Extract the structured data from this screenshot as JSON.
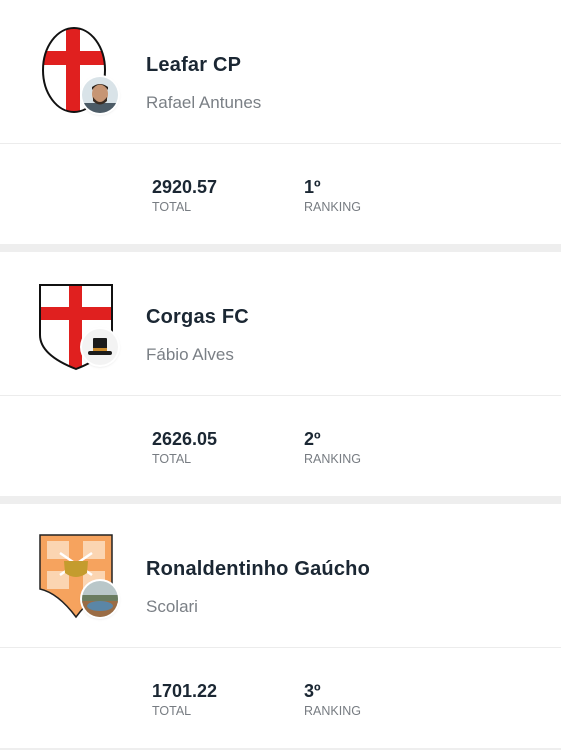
{
  "labels": {
    "total": "TOTAL",
    "ranking": "RANKING"
  },
  "teams": [
    {
      "team_name": "Leafar CP",
      "manager": "Rafael Antunes",
      "total": "2920.57",
      "ranking": "1º",
      "crest": "red-cross-oval-crest",
      "avatar": "man-photo-avatar"
    },
    {
      "team_name": "Corgas FC",
      "manager": "Fábio Alves",
      "total": "2626.05",
      "ranking": "2º",
      "crest": "red-cross-shield-crest",
      "avatar": "top-hat-avatar"
    },
    {
      "team_name": "Ronaldentinho Gaúcho",
      "manager": "Scolari",
      "total": "1701.22",
      "ranking": "3º",
      "crest": "orange-crossed-swords-crest",
      "avatar": "landscape-photo-avatar"
    }
  ],
  "colors": {
    "red": "#e0201f",
    "orange": "#f6a35e",
    "text_dark": "#1b2733",
    "text_muted": "#7a7f85"
  }
}
